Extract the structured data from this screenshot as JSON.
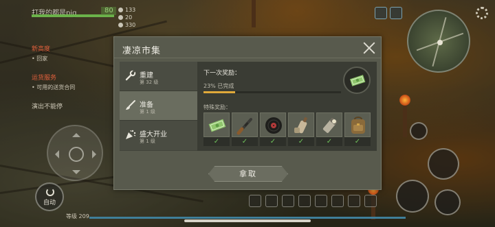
{
  "hud": {
    "player_name": "打我的都是pig",
    "hp_value": "80",
    "stat_1": "133",
    "stat_2": "20",
    "stat_3": "330",
    "quest_1_title": "新高度",
    "quest_1_sub": "• 回家",
    "quest_2_title": "运货服务",
    "quest_2_sub": "• 可用的送货合同",
    "quest_3_title": "演出不能停",
    "auto_button": "自动",
    "level_text": "等级 209",
    "icons": [
      "search-icon",
      "gear-icon",
      "minimap-icon",
      "joystick-icon",
      "fist-icon",
      "hand-icon",
      "sprint-icon"
    ]
  },
  "dialog": {
    "title": "凄凉市集",
    "tabs": [
      {
        "label": "重建",
        "level": "第 32 级",
        "icon": "wrench-icon"
      },
      {
        "label": "准备",
        "level": "第 1 级",
        "icon": "brush-icon"
      },
      {
        "label": "盛大开业",
        "level": "第 1 级",
        "icon": "confetti-icon"
      }
    ],
    "active_tab": 1,
    "next_reward_label": "下一次奖励：",
    "progress_text": "23% 已完成",
    "progress_fraction": 0.23,
    "special_reward_label": "特殊奖励：",
    "special_rewards": [
      {
        "icon": "money-icon",
        "check": "✓"
      },
      {
        "icon": "rifle-icon",
        "check": "✓"
      },
      {
        "icon": "vinyl-record-icon",
        "check": "✓"
      },
      {
        "icon": "bottle-icon",
        "check": "✓"
      },
      {
        "icon": "flashlight-icon",
        "check": "✓"
      },
      {
        "icon": "backpack-icon",
        "check": "✓"
      }
    ],
    "claim_button": "拿取"
  },
  "colors": {
    "progress": "#e0a93a",
    "check": "#6fc25a",
    "quest_title": "#e0603c",
    "hp": "#6bb24a"
  }
}
